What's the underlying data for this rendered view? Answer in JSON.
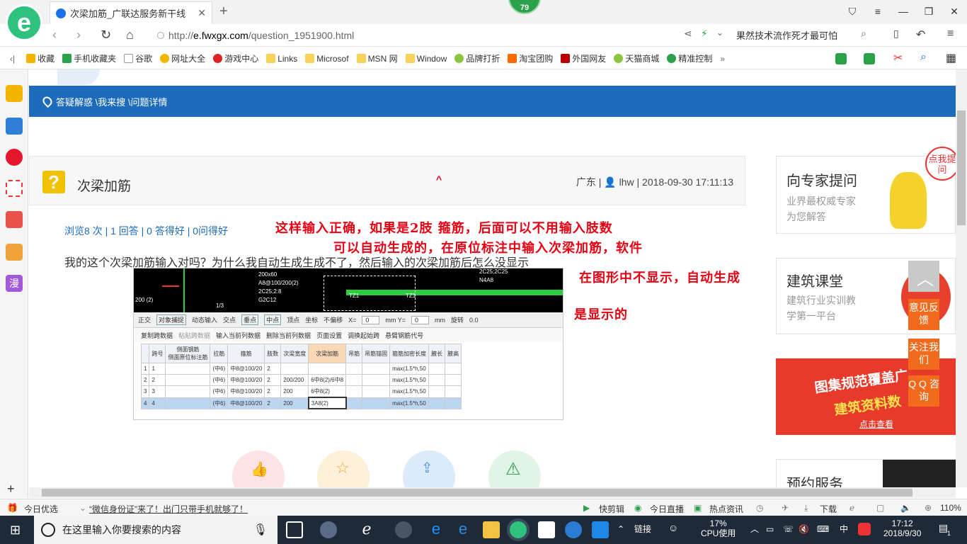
{
  "browser": {
    "tab_title": "次梁加筋_广联达服务新干线",
    "badge_count": "79",
    "url_prefix": "http://",
    "url_host": "e.fwxgx.com",
    "url_path": "/question_1951900.html",
    "search_text": "果然技术流作死才最可怕",
    "bookmarks": [
      "收藏",
      "手机收藏夹",
      "谷歌",
      "网址大全",
      "游戏中心",
      "Links",
      "Microsof",
      "MSN 网",
      "Window",
      "品牌打折",
      "淘宝团购",
      "外国网友",
      "天猫商城",
      "精准控制"
    ]
  },
  "page": {
    "breadcrumb": "答疑解惑 \\我来搜 \\问题详情",
    "question_title": "次梁加筋",
    "question_meta": "广东 | 👤 lhw | 2018-09-30 17:11:13",
    "stats": "浏览8 次 | 1 回答 | 0 答得好 | 0问得好",
    "question_body": "我的这个次梁加筋输入对吗？为什么我自动生成生成不了，然后输入的次梁加筋后怎么没显示",
    "red_caret": "^",
    "annotations": [
      "这样输入正确，如果是2肢 箍筋，后面可以不用输入肢数",
      "可以自动生成的，在原位标注中输入次梁加筋，软件",
      "在图形中不显示，自动生成",
      "是显示的"
    ],
    "screenshot": {
      "cad_labels": [
        "200x60",
        "A8@100(2)",
        "2C25;2C8",
        "G2C12",
        "200x60",
        "A8@100/200(2)",
        "2C25;2:8",
        "G2C12",
        "TZ1",
        "TZ1",
        "200 (2)",
        "1/3",
        "2C25;2C25",
        "N4A8"
      ],
      "toolbar1": [
        "正交",
        "对象捕捉",
        "动态输入",
        "交点",
        "垂点",
        "中点",
        "顶点",
        "坐标",
        "不偏移",
        "X=",
        "0",
        "mm Y=",
        "0",
        "mm",
        "旋转",
        "0.0"
      ],
      "toolbar2": [
        "复制跨数据",
        "粘贴跨数据",
        "输入当前列数据",
        "删除当前列数据",
        "页面设置",
        "调换起始跨",
        "悬臂钢筋代号"
      ],
      "columns": [
        "跨号",
        "侧面钢筋",
        "拉筋",
        "箍筋",
        "肢数",
        "次梁宽度",
        "次梁加筋",
        "吊筋",
        "吊筋锚固",
        "箍筋加密长度",
        "腋长",
        "腋高"
      ],
      "subheader": "侧面原位标注筋",
      "rows": [
        [
          "1",
          "1",
          "",
          "(中6)",
          "中8@100/20",
          "2",
          "",
          "",
          "",
          "",
          "max(1.5*h,50",
          "",
          ""
        ],
        [
          "2",
          "2",
          "",
          "(中6)",
          "中8@100/20",
          "2",
          "200/200",
          "6中8(2)/6中8",
          "",
          "",
          "max(1.5*h,50",
          "",
          ""
        ],
        [
          "3",
          "3",
          "",
          "(中6)",
          "中8@100/20",
          "2",
          "200",
          "6中8(2)",
          "",
          "",
          "max(1.5*h,50",
          "",
          ""
        ],
        [
          "4",
          "4",
          "",
          "(中6)",
          "中8@100/20",
          "2",
          "200",
          "3A8(2)",
          "",
          "",
          "max(1.5*h,50",
          "",
          ""
        ]
      ]
    }
  },
  "sidebar_right": {
    "card1_title": "向专家提问",
    "card1_sub1": "业界最权威专家",
    "card1_sub2": "为您解答",
    "card1_bubble": "点我提问",
    "card2_title": "建筑课堂",
    "card2_sub1": "建筑行业实训教",
    "card2_sub2": "学第一平台",
    "ad_line1": "图集规范覆盖广",
    "ad_line2": "建筑资料数",
    "ad_link": "点击查看",
    "card3_title": "预约服务",
    "float_feedback": "意见反馈",
    "float_follow": "关注我们",
    "float_qq": "Q Q 咨询"
  },
  "statusbar": {
    "today": "今日优选",
    "headline": "“微信身份证”来了！出门只带手机就够了！",
    "quick_clip": "快剪辑",
    "live": "今日直播",
    "hot": "热点资讯",
    "download": "下载",
    "zoom": "110%"
  },
  "taskbar": {
    "search_placeholder": "在这里输入你要搜索的内容",
    "link_label": "链接",
    "cpu_pct": "17%",
    "cpu_label": "CPU使用",
    "ime": "中",
    "time": "17:12",
    "date": "2018/9/30",
    "notif": "1"
  },
  "colors": {
    "brand_blue": "#1c6bbd",
    "annotation_red": "#e60012",
    "float_orange": "#f26b1d"
  }
}
